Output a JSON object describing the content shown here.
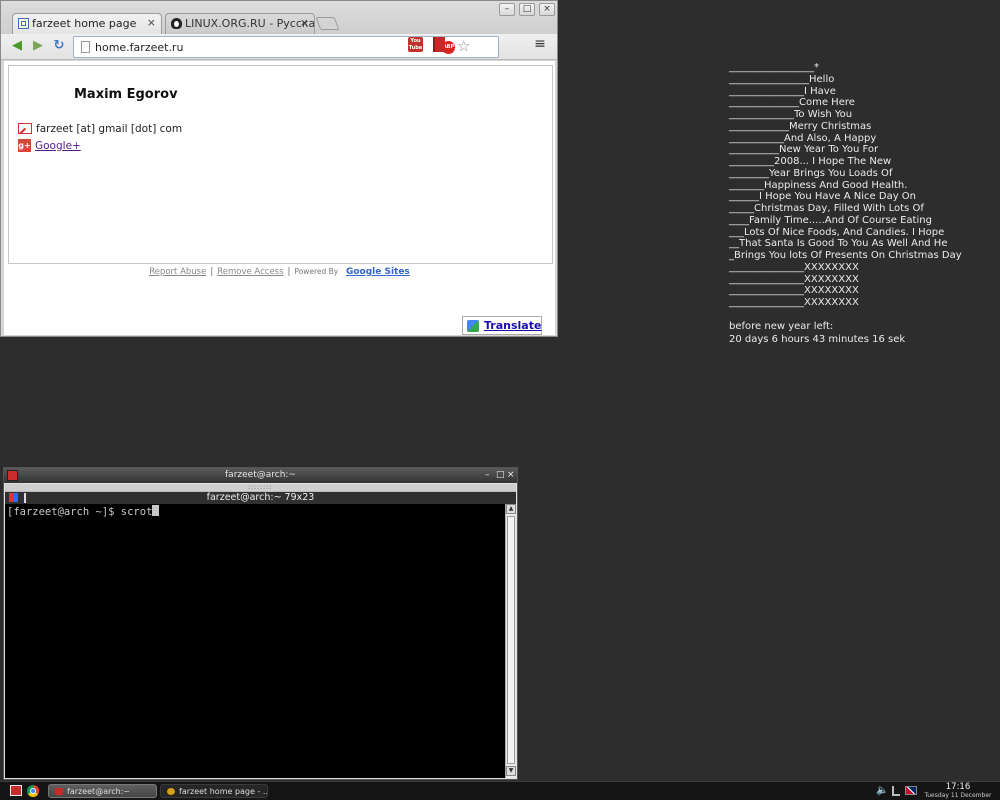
{
  "browser": {
    "tabs": [
      {
        "title": "farzeet home page",
        "active": true
      },
      {
        "title": "LINUX.ORG.RU - Русская",
        "active": false
      }
    ],
    "window_buttons": {
      "minimize": "–",
      "maximize": "□",
      "close": "×"
    },
    "tab_close_glyph": "×",
    "nav": {
      "back_glyph": "◀",
      "forward_glyph": "▶",
      "reload_glyph": "↻"
    },
    "address": "home.farzeet.ru",
    "extensions": {
      "abp_label": "ABP",
      "youtube_label": "You Tube",
      "star_glyph": "☆",
      "menu_glyph": "≡"
    },
    "page": {
      "name": "Maxim Egorov",
      "email": "farzeet [at] gmail [dot] com",
      "gplus_icon_label": "g+",
      "gplus_link": "Google+"
    },
    "footer": {
      "report_abuse": "Report Abuse",
      "separator": "|",
      "remove_access": "Remove Access",
      "powered_by": "Powered By",
      "google_sites": "Google Sites"
    },
    "translate_label": "Translate"
  },
  "desktop_note": {
    "lines": [
      "_________________*",
      "________________Hello",
      "_______________I Have",
      "______________Come Here",
      "_____________To Wish You",
      "____________Merry Christmas",
      "___________And Also, A Happy",
      "__________New Year To You For",
      "_________2008... I Hope The New",
      "________Year Brings You Loads Of",
      "_______Happiness And Good Health.",
      "______I Hope You Have A Nice Day On",
      "_____Christmas Day, Filled With Lots Of",
      "____Family Time.....And Of Course Eating",
      "___Lots Of Nice Foods, And Candies. I Hope",
      "__That Santa Is Good To You As Well And He",
      "_Brings You lots Of Presents On Christmas Day",
      "_______________XXXXXXXX",
      "_______________XXXXXXXX",
      "_______________XXXXXXXX",
      "_______________XXXXXXXX"
    ],
    "countdown_label": "before new year left:",
    "countdown_value": "20 days 6 hours 43 minutes 16 sek"
  },
  "terminal": {
    "window_title": "farzeet@arch:~",
    "window_buttons": {
      "minimize": "–",
      "maximize": "□",
      "close": "×"
    },
    "grip": "::::::::",
    "tab_title": "farzeet@arch:~ 79x23",
    "prompt": "[farzeet@arch ~]$ scrot",
    "scroll_up": "▲",
    "scroll_down": "▼"
  },
  "taskbar": {
    "tasks": [
      {
        "label": "farzeet@arch:~"
      },
      {
        "label": "farzeet home page - ..."
      }
    ],
    "volume_glyph": "🔈",
    "time": "17:16",
    "date": "Tuesday 11 December"
  }
}
